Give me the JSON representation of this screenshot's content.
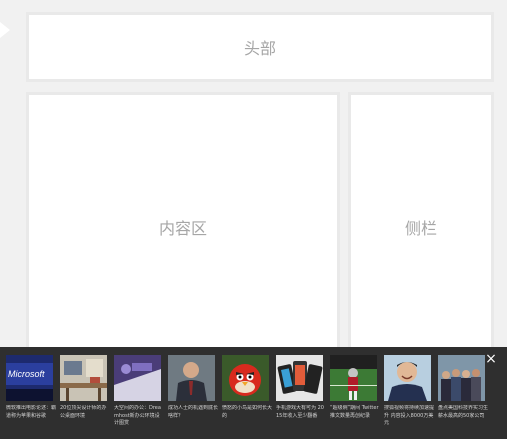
{
  "layout": {
    "header_label": "头部",
    "content_label": "内容区",
    "sidebar_label": "侧栏"
  },
  "news_bar": {
    "close_icon": "×",
    "items": [
      {
        "caption": "微软推出电影论述：霸道称为苹果和谷歌",
        "image": "microsoft-sign"
      },
      {
        "caption": "20位顶尖设计师的办公桌面环境",
        "image": "desk-workspace"
      },
      {
        "caption": "大空间的办公：Dreamhost新办公环境设计图赏",
        "image": "office-space"
      },
      {
        "caption": "成功人士的机遇到底长啥样？",
        "image": "businessman"
      },
      {
        "caption": "愤怒的小鸟是如何长大的",
        "image": "angry-bird"
      },
      {
        "caption": "手机游戏大有可为 2015年收入至少翻番",
        "image": "phone-games"
      },
      {
        "caption": "“超级碗”期间 Twitter推文数量再创纪录",
        "image": "football-game"
      },
      {
        "caption": "搜狐视频将持续加速提升 内容投入8000万美元",
        "image": "smiling-man"
      },
      {
        "caption": "盘点美国科技界实习生薪水最高的50家公司",
        "image": "people-group"
      }
    ]
  }
}
